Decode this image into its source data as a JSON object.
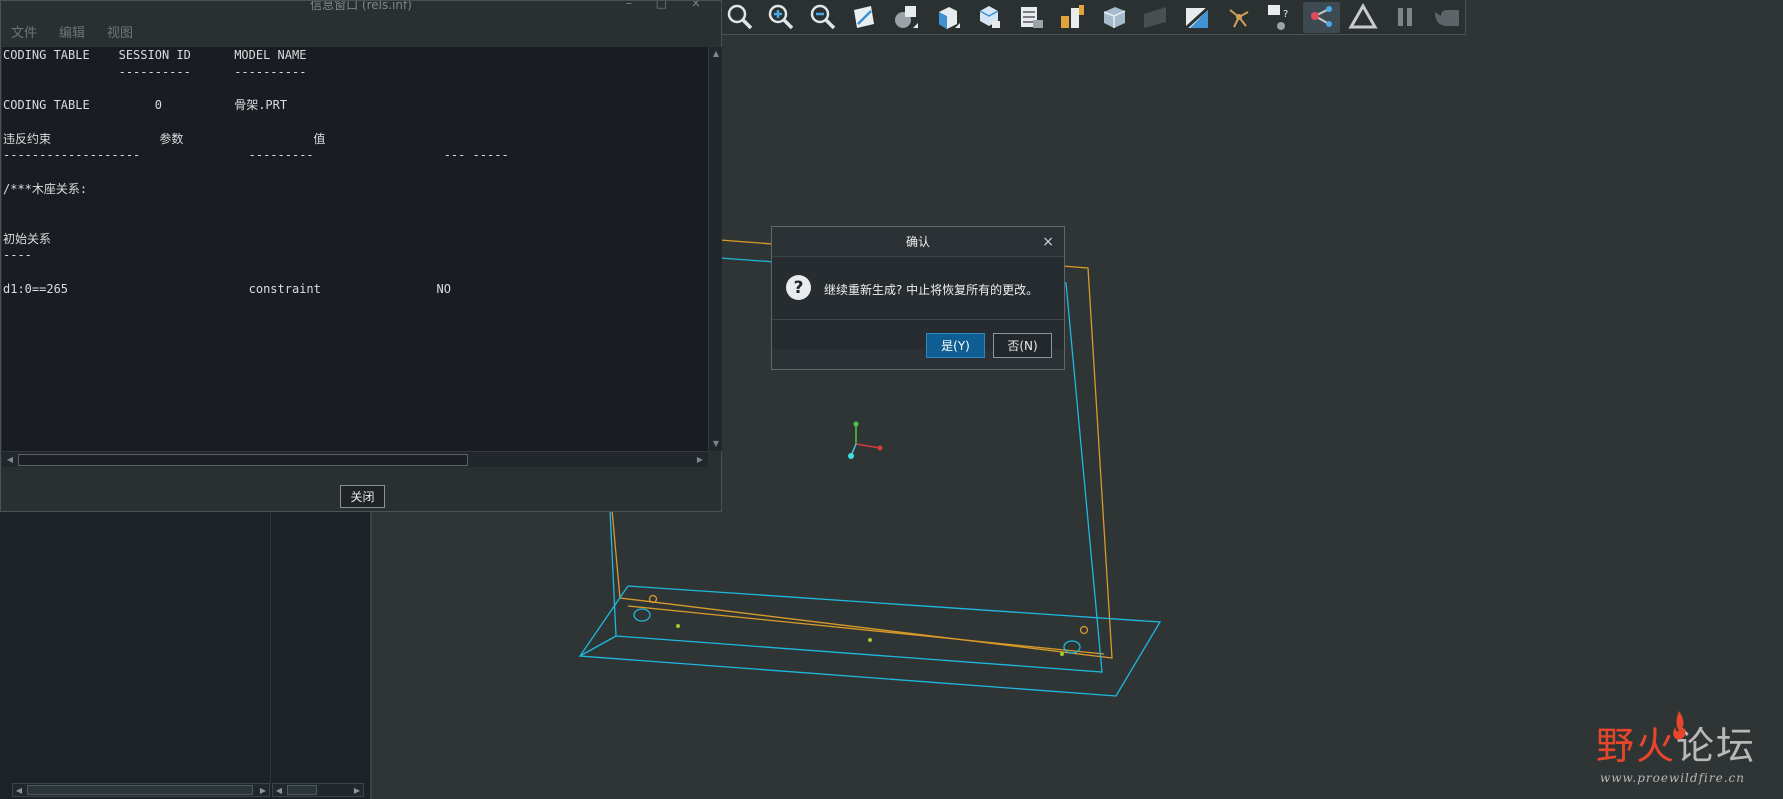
{
  "info_window": {
    "title": "信息窗口 (rels.inf)",
    "menu": [
      {
        "label": "文件"
      },
      {
        "label": "编辑"
      },
      {
        "label": "视图"
      }
    ],
    "content_lines": [
      "CODING TABLE    SESSION ID      MODEL NAME",
      "                ----------      ----------",
      "",
      "CODING TABLE         0          骨架.PRT",
      "",
      "违反约束               参数                  值",
      "-------------------               ---------                  --- -----",
      "",
      "/***木座关系:",
      "",
      "",
      "初始关系",
      "----",
      "",
      "d1:0==265                         constraint                NO"
    ],
    "close_label": "关闭"
  },
  "confirm_dialog": {
    "title": "确认",
    "close_glyph": "×",
    "icon_glyph": "?",
    "message": "继续重新生成? 中止将恢复所有的更改。",
    "yes_label": "是(Y)",
    "no_label": "否(N)"
  },
  "toolbar": {
    "buttons": [
      {
        "icon": "zoom-window-icon"
      },
      {
        "icon": "zoom-in-icon"
      },
      {
        "icon": "zoom-out-icon"
      },
      {
        "icon": "sketch-plane-icon"
      },
      {
        "icon": "shading-icon"
      },
      {
        "icon": "view-cube-icon"
      },
      {
        "icon": "saved-views-icon"
      },
      {
        "icon": "layers-icon"
      },
      {
        "icon": "datum-plane-icon"
      },
      {
        "icon": "transparent-box-icon"
      },
      {
        "icon": "plane-display-icon"
      },
      {
        "icon": "section-icon"
      },
      {
        "icon": "spin-center-icon"
      },
      {
        "icon": "annotation-display-icon"
      },
      {
        "icon": "model-tree-icon"
      },
      {
        "icon": "triangle-icon"
      },
      {
        "icon": "pause-icon"
      },
      {
        "icon": "appearance-icon"
      }
    ]
  },
  "watermark": {
    "logo_part1": "野火",
    "logo_part2": "论坛",
    "url": "www.proewildfire.cn"
  },
  "colors": {
    "background": "#2f3535",
    "edge_cyan": "#1fb8e0",
    "edge_orange": "#d89a2a",
    "accent_blue": "#0f5e93"
  }
}
